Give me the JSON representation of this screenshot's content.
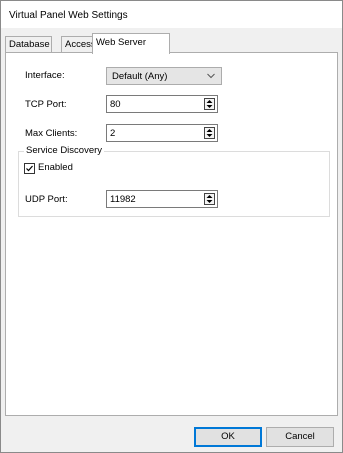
{
  "window": {
    "title": "Virtual Panel Web Settings"
  },
  "tabs": [
    {
      "label": "Database",
      "active": false
    },
    {
      "label": "Access",
      "active": false
    },
    {
      "label": "Web Server",
      "active": true
    }
  ],
  "web_server": {
    "interface": {
      "label": "Interface:",
      "value": "Default (Any)"
    },
    "tcp_port": {
      "label": "TCP Port:",
      "value": "80"
    },
    "max_clients": {
      "label": "Max Clients:",
      "value": "2"
    },
    "service_discovery": {
      "legend": "Service Discovery",
      "enabled": {
        "label": "Enabled",
        "checked": true
      },
      "udp_port": {
        "label": "UDP Port:",
        "value": "11982"
      }
    }
  },
  "buttons": {
    "ok": "OK",
    "cancel": "Cancel"
  },
  "colors": {
    "accent": "#0078d7",
    "dialog_bg": "#f0f0f0",
    "panel_bg": "#ffffff"
  }
}
